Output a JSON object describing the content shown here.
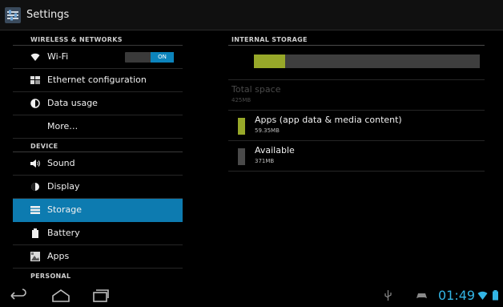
{
  "app": {
    "title": "Settings",
    "icon": "settings-sliders-icon"
  },
  "sidebar": {
    "sections": [
      {
        "header": "WIRELESS & NETWORKS"
      },
      {
        "header": "DEVICE"
      },
      {
        "header": "PERSONAL"
      }
    ],
    "items": [
      {
        "label": "Wi-Fi",
        "icon": "wifi-icon"
      },
      {
        "label": "Ethernet configuration",
        "icon": "ethernet-icon"
      },
      {
        "label": "Data usage",
        "icon": "data-usage-icon"
      },
      {
        "label": "More…",
        "icon": ""
      },
      {
        "label": "Sound",
        "icon": "speaker-icon"
      },
      {
        "label": "Display",
        "icon": "display-icon"
      },
      {
        "label": "Storage",
        "icon": "storage-icon"
      },
      {
        "label": "Battery",
        "icon": "battery-icon"
      },
      {
        "label": "Apps",
        "icon": "apps-icon"
      }
    ],
    "wifi_toggle": {
      "state": "ON"
    },
    "selected_item": "Storage",
    "selected_color": "#0d7bb0"
  },
  "storage": {
    "header": "INTERNAL STORAGE",
    "usage_fraction": 0.138,
    "total_label": "Total space",
    "total_value": "425MB",
    "apps_label": "Apps (app data & media content)",
    "apps_value": "59.35MB",
    "apps_color": "#97a829",
    "available_label": "Available",
    "available_value": "371MB",
    "available_color": "#4a4a4a"
  },
  "status": {
    "time": "01:49",
    "accent_color": "#33b5e5"
  }
}
